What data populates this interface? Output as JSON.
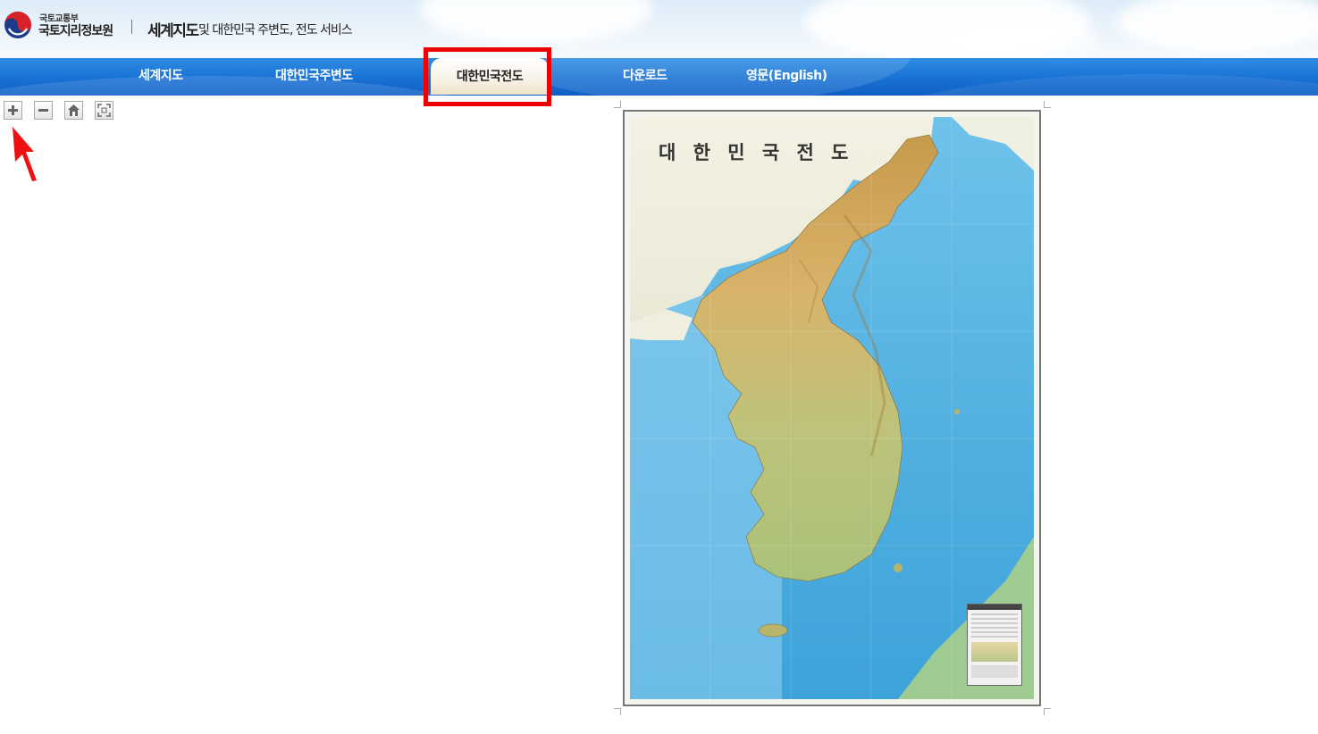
{
  "header": {
    "org_ministry": "국토교통부",
    "org_name": "국토지리정보원",
    "service_title": "세계지도",
    "service_subtitle": "및 대한민국 주변도, 전도 서비스"
  },
  "nav": {
    "items": [
      {
        "label": "세계지도",
        "active": false
      },
      {
        "label": "대한민국주변도",
        "active": false
      },
      {
        "label": "대한민국전도",
        "active": true
      },
      {
        "label": "다운로드",
        "active": false
      },
      {
        "label": "영문(English)",
        "active": false
      }
    ]
  },
  "toolbar": {
    "buttons": [
      {
        "icon": "zoom-in-icon"
      },
      {
        "icon": "zoom-out-icon"
      },
      {
        "icon": "home-icon"
      },
      {
        "icon": "full-extent-icon"
      }
    ]
  },
  "map": {
    "title": "대 한 민 국 전 도"
  },
  "colors": {
    "nav_blue": "#1a74d6",
    "highlight_red": "#ee0000",
    "sea": "#4faedf",
    "land": "#d9b36a"
  }
}
